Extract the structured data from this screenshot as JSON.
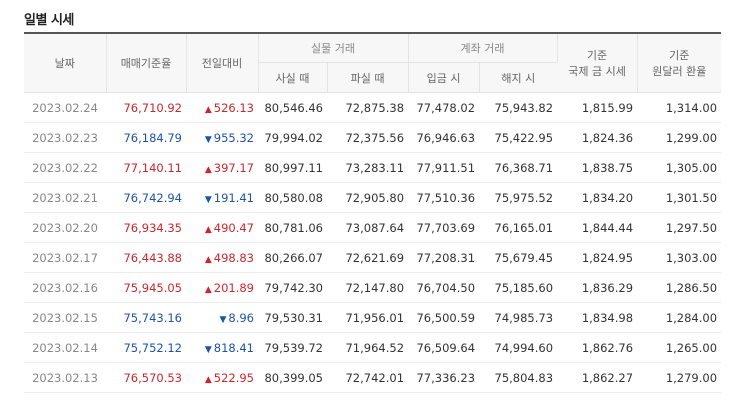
{
  "title": "일별 시세",
  "headers": {
    "date": "날짜",
    "base_rate": "매매기준율",
    "change": "전일대비",
    "cash_group": "실물 거래",
    "cash_sell": "사실 때",
    "cash_buy": "파실 때",
    "account_group": "계좌 거래",
    "deposit": "입금 시",
    "withdraw": "해지 시",
    "intl_gold_l1": "기준",
    "intl_gold_l2": "국제 금 시세",
    "usd_krw_l1": "기준",
    "usd_krw_l2": "원달러 환율"
  },
  "colors": {
    "up": "#c8282d",
    "down": "#1c54a6"
  },
  "rows": [
    {
      "date": "2023.02.24",
      "base": "76,710.92",
      "dir": "up",
      "arrow": "▲",
      "change": "526.13",
      "sell": "80,546.46",
      "buy": "72,875.38",
      "deposit": "77,478.02",
      "withdraw": "75,943.82",
      "intl": "1,815.99",
      "rate": "1,314.00"
    },
    {
      "date": "2023.02.23",
      "base": "76,184.79",
      "dir": "down",
      "arrow": "▼",
      "change": "955.32",
      "sell": "79,994.02",
      "buy": "72,375.56",
      "deposit": "76,946.63",
      "withdraw": "75,422.95",
      "intl": "1,824.36",
      "rate": "1,299.00"
    },
    {
      "date": "2023.02.22",
      "base": "77,140.11",
      "dir": "up",
      "arrow": "▲",
      "change": "397.17",
      "sell": "80,997.11",
      "buy": "73,283.11",
      "deposit": "77,911.51",
      "withdraw": "76,368.71",
      "intl": "1,838.75",
      "rate": "1,305.00"
    },
    {
      "date": "2023.02.21",
      "base": "76,742.94",
      "dir": "down",
      "arrow": "▼",
      "change": "191.41",
      "sell": "80,580.08",
      "buy": "72,905.80",
      "deposit": "77,510.36",
      "withdraw": "75,975.52",
      "intl": "1,834.20",
      "rate": "1,301.50"
    },
    {
      "date": "2023.02.20",
      "base": "76,934.35",
      "dir": "up",
      "arrow": "▲",
      "change": "490.47",
      "sell": "80,781.06",
      "buy": "73,087.64",
      "deposit": "77,703.69",
      "withdraw": "76,165.01",
      "intl": "1,844.44",
      "rate": "1,297.50"
    },
    {
      "date": "2023.02.17",
      "base": "76,443.88",
      "dir": "up",
      "arrow": "▲",
      "change": "498.83",
      "sell": "80,266.07",
      "buy": "72,621.69",
      "deposit": "77,208.31",
      "withdraw": "75,679.45",
      "intl": "1,824.95",
      "rate": "1,303.00"
    },
    {
      "date": "2023.02.16",
      "base": "75,945.05",
      "dir": "up",
      "arrow": "▲",
      "change": "201.89",
      "sell": "79,742.30",
      "buy": "72,147.80",
      "deposit": "76,704.50",
      "withdraw": "75,185.60",
      "intl": "1,836.29",
      "rate": "1,286.50"
    },
    {
      "date": "2023.02.15",
      "base": "75,743.16",
      "dir": "down",
      "arrow": "▼",
      "change": "8.96",
      "sell": "79,530.31",
      "buy": "71,956.01",
      "deposit": "76,500.59",
      "withdraw": "74,985.73",
      "intl": "1,834.98",
      "rate": "1,284.00"
    },
    {
      "date": "2023.02.14",
      "base": "75,752.12",
      "dir": "down",
      "arrow": "▼",
      "change": "818.41",
      "sell": "79,539.72",
      "buy": "71,964.52",
      "deposit": "76,509.64",
      "withdraw": "74,994.60",
      "intl": "1,862.76",
      "rate": "1,265.00"
    },
    {
      "date": "2023.02.13",
      "base": "76,570.53",
      "dir": "up",
      "arrow": "▲",
      "change": "522.95",
      "sell": "80,399.05",
      "buy": "72,742.01",
      "deposit": "77,336.23",
      "withdraw": "75,804.83",
      "intl": "1,862.27",
      "rate": "1,279.00"
    }
  ]
}
